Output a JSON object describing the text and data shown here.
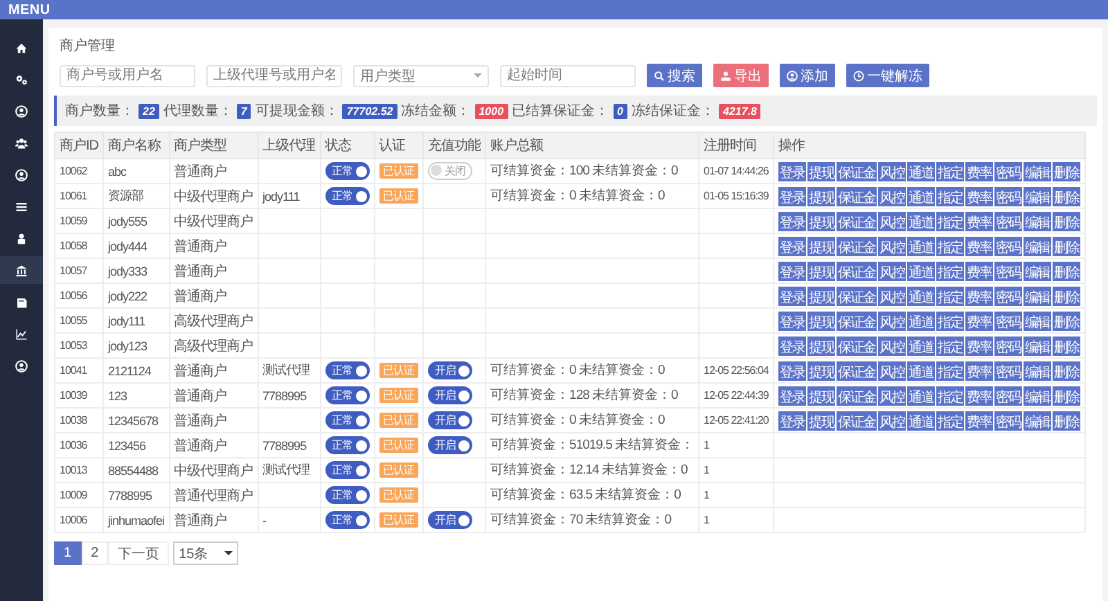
{
  "topbar": {
    "title": "MENU"
  },
  "sidebar": {
    "items": [
      {
        "selected": false
      },
      {
        "selected": false
      },
      {
        "selected": false
      },
      {
        "selected": false
      },
      {
        "selected": false
      },
      {
        "selected": false
      },
      {
        "selected": false
      },
      {
        "selected": true
      },
      {
        "selected": false
      },
      {
        "selected": false
      },
      {
        "selected": false
      }
    ]
  },
  "page_title": "商户管理",
  "filters": [
    {
      "kind": "input",
      "placeholder": "商户号或用户名"
    },
    {
      "kind": "input",
      "placeholder": "上级代理号或用户名"
    },
    {
      "kind": "select",
      "placeholder": "用户类型"
    },
    {
      "kind": "input",
      "placeholder": "起始时间"
    }
  ],
  "buttons": [
    {
      "label": "搜索",
      "kind": "primary"
    },
    {
      "label": "导出",
      "kind": "danger"
    },
    {
      "label": "添加",
      "kind": "primary"
    },
    {
      "label": "一键解冻",
      "kind": "primary"
    }
  ],
  "stats": [
    {
      "label": "商户数量：",
      "value": "22",
      "color": "#3f5cc0"
    },
    {
      "label": "代理数量：",
      "value": "7",
      "color": "#3f5cc0"
    },
    {
      "label": "可提现金额：",
      "value": "77702.52",
      "color": "#3f5cc0"
    },
    {
      "label": "冻结金额：",
      "value": "1000",
      "color": "#e8505f"
    },
    {
      "label": "已结算保证金：",
      "value": "0",
      "color": "#3f5cc0"
    },
    {
      "label": "冻结保证金：",
      "value": "4217.8",
      "color": "#e8505f"
    }
  ],
  "table": {
    "columns": [
      "商户ID",
      "商户名称",
      "商户类型",
      "上级代理",
      "状态",
      "认证",
      "充值功能",
      "账户总额",
      "注册时间",
      "操作"
    ],
    "rows": [
      {
        "id": "10062",
        "name": "abc",
        "type": "普通商户",
        "parent": "",
        "status": {
          "label": "正常",
          "on": true
        },
        "auth": "已认证",
        "recharge": {
          "label": "关闭",
          "on": false
        },
        "balance": "可结算资金：100 未结算资金：0",
        "time": "01-07 14:44:26",
        "actions": [
          "登录",
          "提现",
          "保证金",
          "风控",
          "通道",
          "指定",
          "费率",
          "密码",
          "编辑",
          "删除"
        ]
      },
      {
        "id": "10061",
        "name": "资源部",
        "type": "中级代理商户",
        "parent": "jody111",
        "status": {
          "label": "正常",
          "on": true
        },
        "auth": "已认证",
        "balance": "可结算资金：0 未结算资金：0",
        "time": "01-05 15:16:39",
        "actions": [
          "登录",
          "提现",
          "保证金",
          "风控",
          "通道",
          "指定",
          "费率",
          "密码",
          "编辑",
          "删除"
        ]
      },
      {
        "id": "10059",
        "name": "jody555",
        "type": "中级代理商户",
        "actions": [
          "登录",
          "提现",
          "保证金",
          "风控",
          "通道",
          "指定",
          "费率",
          "密码",
          "编辑",
          "删除"
        ]
      },
      {
        "id": "10058",
        "name": "jody444",
        "type": "普通商户",
        "actions": [
          "登录",
          "提现",
          "保证金",
          "风控",
          "通道",
          "指定",
          "费率",
          "密码",
          "编辑",
          "删除"
        ]
      },
      {
        "id": "10057",
        "name": "jody333",
        "type": "普通商户",
        "actions": [
          "登录",
          "提现",
          "保证金",
          "风控",
          "通道",
          "指定",
          "费率",
          "密码",
          "编辑",
          "删除"
        ]
      },
      {
        "id": "10056",
        "name": "jody222",
        "type": "普通商户",
        "actions": [
          "登录",
          "提现",
          "保证金",
          "风控",
          "通道",
          "指定",
          "费率",
          "密码",
          "编辑",
          "删除"
        ]
      },
      {
        "id": "10055",
        "name": "jody111",
        "type": "高级代理商户",
        "actions": [
          "登录",
          "提现",
          "保证金",
          "风控",
          "通道",
          "指定",
          "费率",
          "密码",
          "编辑",
          "删除"
        ]
      },
      {
        "id": "10053",
        "name": "jody123",
        "type": "高级代理商户",
        "actions": [
          "登录",
          "提现",
          "保证金",
          "风控",
          "通道",
          "指定",
          "费率",
          "密码",
          "编辑",
          "删除"
        ]
      },
      {
        "id": "10041",
        "name": "2121124",
        "type": "普通商户",
        "parent": "测试代理",
        "status": {
          "label": "正常",
          "on": true
        },
        "auth": "已认证",
        "recharge": {
          "label": "开启",
          "on": true
        },
        "balance": "可结算资金：0 未结算资金：0",
        "time": "12-05 22:56:04",
        "actions": [
          "登录",
          "提现",
          "保证金",
          "风控",
          "通道",
          "指定",
          "费率",
          "密码",
          "编辑",
          "删除"
        ]
      },
      {
        "id": "10039",
        "name": "123",
        "type": "普通商户",
        "parent": "7788995",
        "status": {
          "label": "正常",
          "on": true
        },
        "auth": "已认证",
        "recharge": {
          "label": "开启",
          "on": true
        },
        "balance": "可结算资金：128 未结算资金：0",
        "time": "12-05 22:44:39",
        "actions": [
          "登录",
          "提现",
          "保证金",
          "风控",
          "通道",
          "指定",
          "费率",
          "密码",
          "编辑",
          "删除"
        ]
      },
      {
        "id": "10038",
        "name": "12345678",
        "type": "普通商户",
        "parent": "",
        "status": {
          "label": "正常",
          "on": true
        },
        "auth": "已认证",
        "recharge": {
          "label": "开启",
          "on": true
        },
        "balance": "可结算资金：0 未结算资金：0",
        "time": "12-05 22:41:20",
        "actions": [
          "登录",
          "提现",
          "保证金",
          "风控",
          "通道",
          "指定",
          "费率",
          "密码",
          "编辑",
          "删除"
        ]
      },
      {
        "id": "10036",
        "name": "123456",
        "type": "普通商户",
        "parent": "7788995",
        "status": {
          "label": "正常",
          "on": true
        },
        "auth": "已认证",
        "recharge": {
          "label": "开启",
          "on": true
        },
        "balance": "可结算资金：51019.5 未结算资金：",
        "time": "1"
      },
      {
        "id": "10013",
        "name": "88554488",
        "type": "中级代理商户",
        "parent": "测试代理",
        "status": {
          "label": "正常",
          "on": true
        },
        "auth": "已认证",
        "balance": "可结算资金：12.14 未结算资金：0",
        "time": "1"
      },
      {
        "id": "10009",
        "name": "7788995",
        "type": "普通代理商户",
        "parent": "",
        "status": {
          "label": "正常",
          "on": true
        },
        "auth": "已认证",
        "balance": "可结算资金：63.5 未结算资金：0",
        "time": "1"
      },
      {
        "id": "10006",
        "name": "jinhumaofei",
        "type": "普通商户",
        "parent": "-",
        "status": {
          "label": "正常",
          "on": true
        },
        "auth": "已认证",
        "recharge": {
          "label": "开启",
          "on": true
        },
        "balance": "可结算资金：70 未结算资金：0",
        "time": "1"
      }
    ]
  },
  "pagination": {
    "pages": [
      {
        "label": "1",
        "selected": true
      },
      {
        "label": "2",
        "selected": false
      }
    ],
    "next": "下一页",
    "page_size": "15条"
  }
}
